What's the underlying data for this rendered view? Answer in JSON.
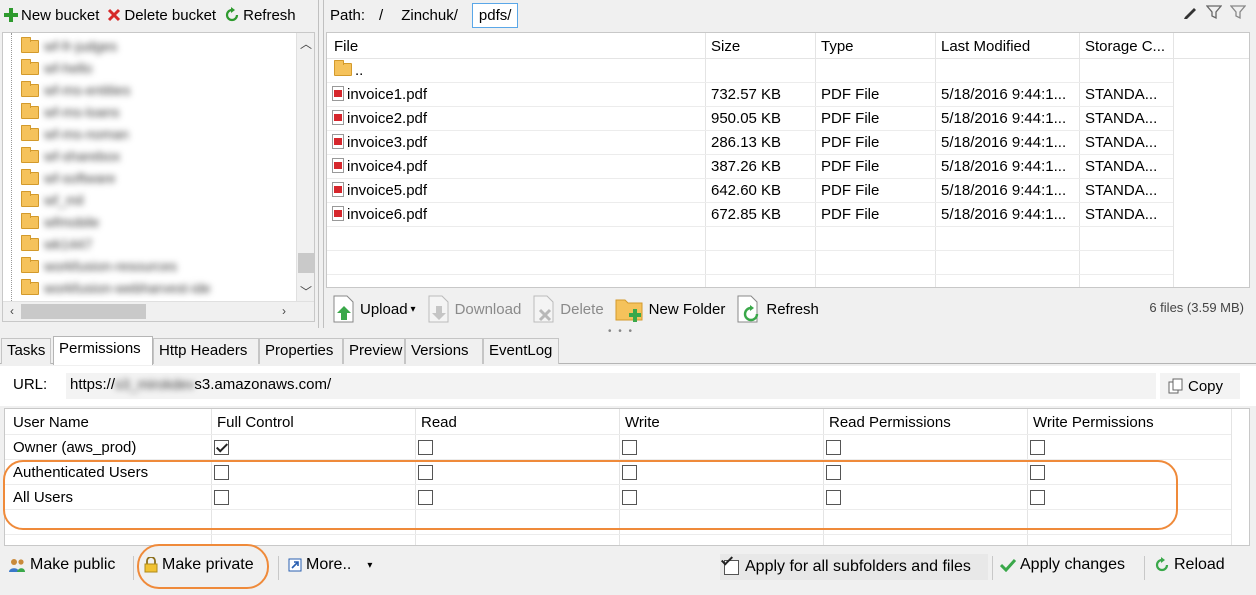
{
  "left_toolbar": {
    "new_bucket": "New bucket",
    "delete_bucket": "Delete bucket",
    "refresh": "Refresh"
  },
  "tree": {
    "items": [
      "wf-fr-judges",
      "wf-hello",
      "wf-ms-entities",
      "wf-ms-loans",
      "wf-ms-noman",
      "wf-sharebox",
      "wf-software",
      "wf_mil",
      "wfmobile",
      "wk1447",
      "workfusion-resources",
      "workfusion-webharvest-ide"
    ]
  },
  "path": {
    "label": "Path:",
    "root": "/",
    "segments": [
      "Zinchuk/",
      "pdfs/"
    ]
  },
  "file_list": {
    "columns": [
      "File",
      "Size",
      "Type",
      "Last Modified",
      "Storage C..."
    ],
    "parent": "..",
    "rows": [
      {
        "name": "invoice1.pdf",
        "size": "732.57 KB",
        "type": "PDF File",
        "modified": "5/18/2016 9:44:1...",
        "storage": "STANDA..."
      },
      {
        "name": "invoice2.pdf",
        "size": "950.05 KB",
        "type": "PDF File",
        "modified": "5/18/2016 9:44:1...",
        "storage": "STANDA..."
      },
      {
        "name": "invoice3.pdf",
        "size": "286.13 KB",
        "type": "PDF File",
        "modified": "5/18/2016 9:44:1...",
        "storage": "STANDA..."
      },
      {
        "name": "invoice4.pdf",
        "size": "387.26 KB",
        "type": "PDF File",
        "modified": "5/18/2016 9:44:1...",
        "storage": "STANDA..."
      },
      {
        "name": "invoice5.pdf",
        "size": "642.60 KB",
        "type": "PDF File",
        "modified": "5/18/2016 9:44:1...",
        "storage": "STANDA..."
      },
      {
        "name": "invoice6.pdf",
        "size": "672.85 KB",
        "type": "PDF File",
        "modified": "5/18/2016 9:44:1...",
        "storage": "STANDA..."
      }
    ]
  },
  "file_toolbar": {
    "upload": "Upload",
    "download": "Download",
    "delete": "Delete",
    "new_folder": "New Folder",
    "refresh": "Refresh",
    "file_count": "6 files (3.59 MB)"
  },
  "tabs": [
    "Tasks",
    "Permissions",
    "Http Headers",
    "Properties",
    "Preview",
    "Versions",
    "EventLog"
  ],
  "active_tab": "Permissions",
  "permissions": {
    "url_label": "URL:",
    "url_prefix": "https://",
    "url_hidden": "s3_mirokdev",
    "url_suffix": "s3.amazonaws.com/",
    "copy": "Copy",
    "columns": [
      "User Name",
      "Full Control",
      "Read",
      "Write",
      "Read Permissions",
      "Write Permissions"
    ],
    "rows": [
      {
        "user": "Owner (aws_prod)",
        "values": [
          true,
          false,
          false,
          false,
          false
        ]
      },
      {
        "user": "Authenticated Users",
        "values": [
          false,
          false,
          false,
          false,
          false
        ]
      },
      {
        "user": "All Users",
        "values": [
          false,
          false,
          false,
          false,
          false
        ]
      }
    ]
  },
  "perm_toolbar": {
    "make_public": "Make public",
    "make_private": "Make private",
    "more": "More..",
    "apply_all": "Apply for all subfolders and files",
    "apply_all_checked": true,
    "apply_changes": "Apply changes",
    "reload": "Reload"
  },
  "colors": {
    "highlight": "#ef8a3a",
    "folder": "#f5c25b",
    "selected_border": "#5aa7e8"
  }
}
